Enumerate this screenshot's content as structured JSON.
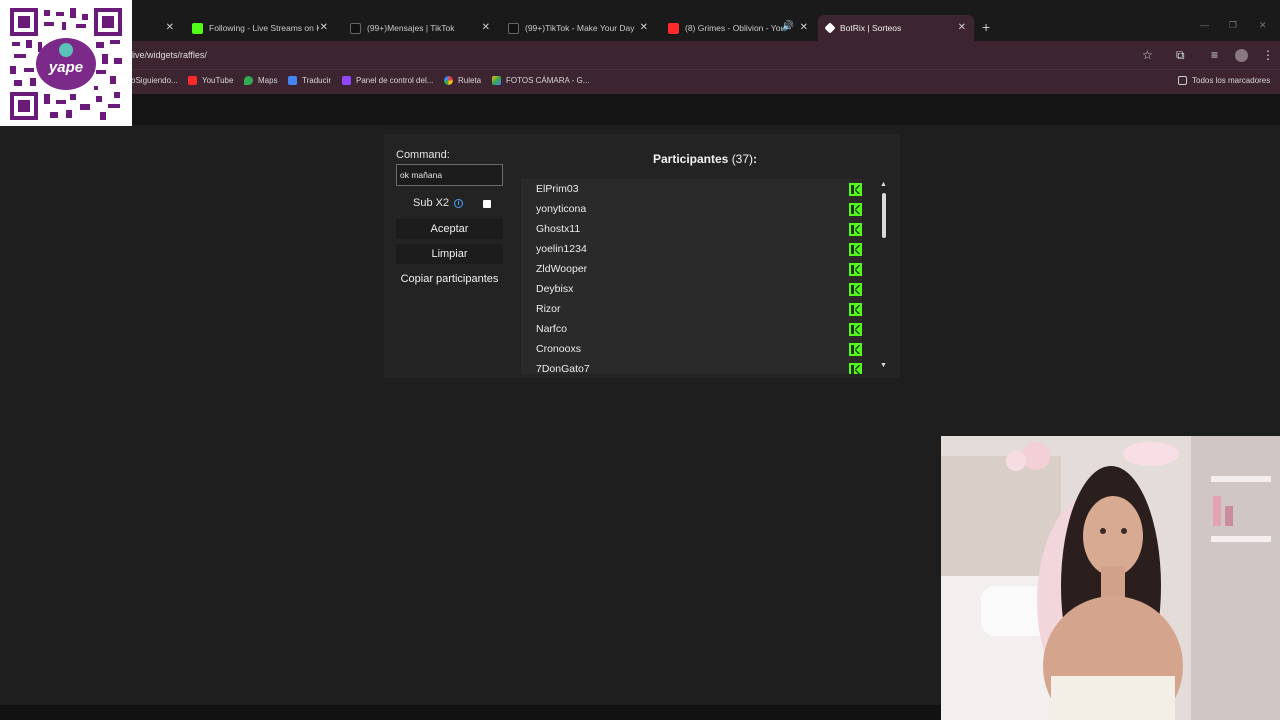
{
  "browser": {
    "tabs": [
      {
        "title": "d",
        "active": false
      },
      {
        "title": "Following - Live Streams on Ki",
        "active": false
      },
      {
        "title": "(99+)Mensajes | TikTok",
        "active": false
      },
      {
        "title": "(99+)TikTok - Make Your Day",
        "active": false
      },
      {
        "title": "(8) Grimes - Oblivion - YouT",
        "active": false
      },
      {
        "title": "BotRix | Sorteos",
        "active": true
      }
    ],
    "url": "live/widgets/raffles/",
    "bookmarks": [
      {
        "label": "oSiguiendo..."
      },
      {
        "label": "YouTube"
      },
      {
        "label": "Maps"
      },
      {
        "label": "Traducir"
      },
      {
        "label": "Panel de control del..."
      },
      {
        "label": "Ruleta"
      },
      {
        "label": "FOTOS CÁMARA - G..."
      }
    ],
    "all_bookmarks": "Todos los marcadores"
  },
  "overlay": {
    "qr_brand": "yape"
  },
  "raffle": {
    "command_label": "Command:",
    "command_value": "ok mañana",
    "sub_label": "Sub X2",
    "sub_checked": false,
    "accept_label": "Aceptar",
    "clear_label": "Limpiar",
    "copy_label": "Copiar participantes",
    "participants_title": "Participantes",
    "participants_count": "(37)",
    "participants_colon": ":",
    "participants": [
      "ElPrim03",
      "yonyticona",
      "Ghostx11",
      "yoelin1234",
      "ZldWooper",
      "Deybisx",
      "Rizor",
      "Narfco",
      "Cronooxs",
      "7DonGato7"
    ],
    "platform_icon": "kick-icon"
  },
  "colors": {
    "accent_chrome": "#3c2530",
    "kick_green": "#53fc18",
    "page_bg": "#1e1e1e"
  }
}
